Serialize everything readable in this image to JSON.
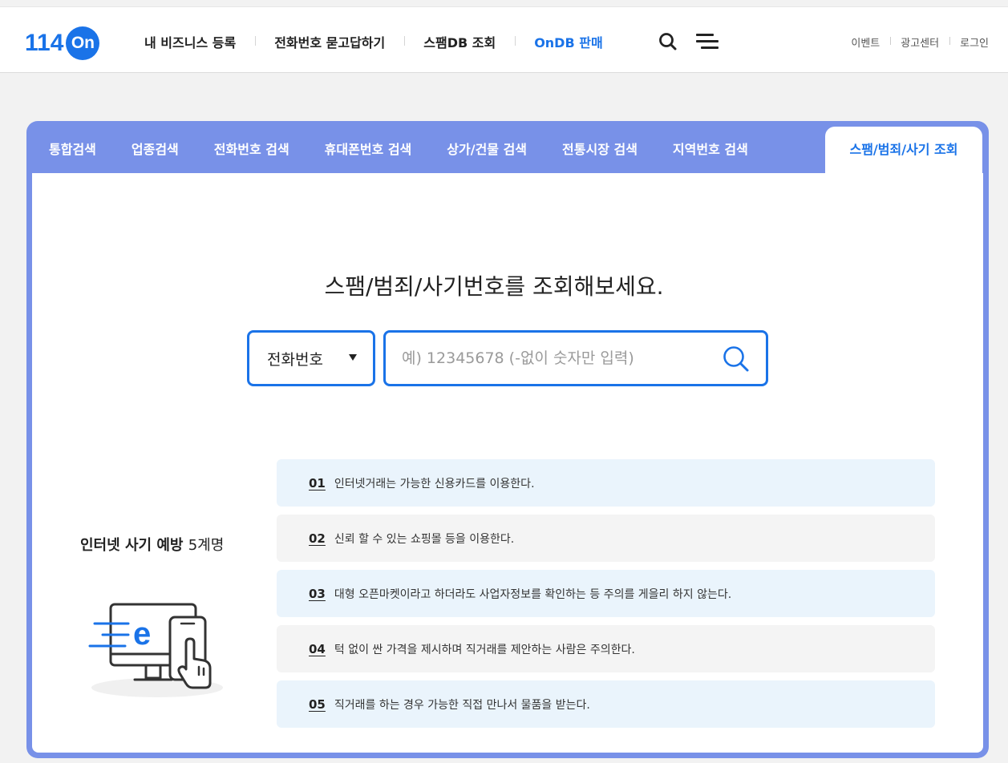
{
  "logo": {
    "number": "114",
    "badge": "On"
  },
  "gnb": {
    "items": [
      {
        "label": "내 비즈니스 등록"
      },
      {
        "label": "전화번호 묻고답하기"
      },
      {
        "label": "스팸DB 조회"
      },
      {
        "label": "OnDB 판매"
      }
    ],
    "search_icon": "search-icon",
    "menu_icon": "hamburger-menu-icon"
  },
  "util": {
    "items": [
      "이벤트",
      "광고센터",
      "로그인"
    ]
  },
  "tabs": {
    "items": [
      "통합검색",
      "업종검색",
      "전화번호 검색",
      "휴대폰번호 검색",
      "상가/건물 검색",
      "전통시장 검색",
      "지역번호 검색"
    ],
    "active": "스팸/범죄/사기 조회"
  },
  "search": {
    "title": "스팸/범죄/사기번호를 조회해보세요.",
    "select_value": "전화번호",
    "placeholder": "예) 12345678 (-없이 숫자만 입력)",
    "button_icon": "search-icon"
  },
  "tips": {
    "title_bold": "인터넷 사기 예방",
    "title_light": "5계명",
    "items": [
      {
        "num": "01",
        "text": "인터넷거래는 가능한 신용카드를 이용한다."
      },
      {
        "num": "02",
        "text": "신뢰 할 수 있는 쇼핑몰 등을 이용한다."
      },
      {
        "num": "03",
        "text": "대형 오픈마켓이라고 하더라도 사업자정보를 확인하는 등 주의를 게을리 하지 않는다."
      },
      {
        "num": "04",
        "text": "턱 없이 싼 가격을 제시하며 직거래를 제안하는 사람은 주의한다."
      },
      {
        "num": "05",
        "text": "직거래를 하는 경우 가능한 직접 만나서 물품을 받는다."
      }
    ]
  },
  "colors": {
    "brand": "#1a73e8",
    "panel": "#7891e8",
    "tip_odd": "#eaf4fc",
    "tip_even": "#f4f4f4"
  }
}
